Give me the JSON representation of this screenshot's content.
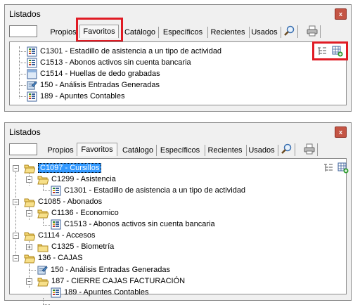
{
  "window1": {
    "title": "Listados",
    "close_label": "x",
    "tabs": [
      "Propios",
      "Favoritos",
      "Catálogo",
      "Específicos",
      "Recientes",
      "Usados"
    ],
    "selected_tab": "Favoritos",
    "items": [
      {
        "label": "C1301 - Estadillo de asistencia a un tipo de actividad",
        "icon": "report-icon"
      },
      {
        "label": "C1513 - Abonos activos sin cuenta bancaria",
        "icon": "report-icon"
      },
      {
        "label": "C1514 - Huellas de dedo grabadas",
        "icon": "blank-report-icon"
      },
      {
        "label": "150 - Análisis Entradas Generadas",
        "icon": "analysis-icon"
      },
      {
        "label": "189 - Apuntes Contables",
        "icon": "report-icon"
      }
    ]
  },
  "window2": {
    "title": "Listados",
    "close_label": "x",
    "tabs": [
      "Propios",
      "Favoritos",
      "Catálogo",
      "Específicos",
      "Recientes",
      "Usados"
    ],
    "selected_tab": "Favoritos",
    "tree": [
      {
        "label": "C1097 - Cursillos",
        "type": "folder"
      },
      {
        "label": "C1299 - Asistencia",
        "type": "folder"
      },
      {
        "label": "C1301 - Estadillo de asistencia a un tipo de actividad",
        "type": "report"
      },
      {
        "label": "C1085 - Abonados",
        "type": "folder"
      },
      {
        "label": "C1136 - Economico",
        "type": "folder"
      },
      {
        "label": "C1513 - Abonos activos sin cuenta bancaria",
        "type": "report"
      },
      {
        "label": "C1114 - Accesos",
        "type": "folder"
      },
      {
        "label": "C1325 - Biometría",
        "type": "folder"
      },
      {
        "label": "136 - CAJAS",
        "type": "folder"
      },
      {
        "label": "150 - Análisis Entradas Generadas",
        "type": "analysis"
      },
      {
        "label": "187 - CIERRE CAJAS FACTURACIÓN",
        "type": "folder"
      },
      {
        "label": "189 - Apuntes Contables",
        "type": "report"
      }
    ]
  },
  "colors": {
    "highlight": "#e01b24",
    "selection": "#3399ff",
    "close": "#c45545"
  }
}
